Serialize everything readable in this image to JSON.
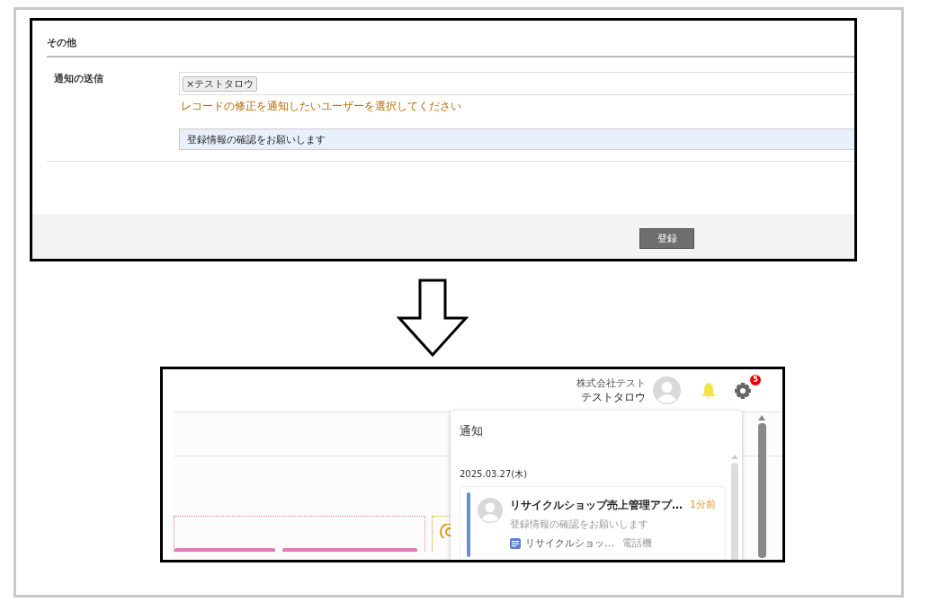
{
  "top_screenshot": {
    "section_title": "その他",
    "field_label": "通知の送信",
    "user_chips": [
      {
        "label": "×テストタロウ"
      }
    ],
    "hint": "レコードの修正を通知したいユーザーを選択してください",
    "message_value": "登録情報の確認をお願いします",
    "submit_button": "登録"
  },
  "bottom_screenshot": {
    "company": "株式会社テスト",
    "user_name": "テストタロウ",
    "settings_badge": "5",
    "notification_panel": {
      "title": "通知",
      "date": "2025.03.27(木)",
      "items": [
        {
          "app_title": "リサイクルショップ売上管理アプ…",
          "time": "1分前",
          "message": "登録情報の確認をお願いします",
          "app_name": "リサイクルショッ…",
          "record": "電話機",
          "unread": true
        }
      ]
    }
  }
}
